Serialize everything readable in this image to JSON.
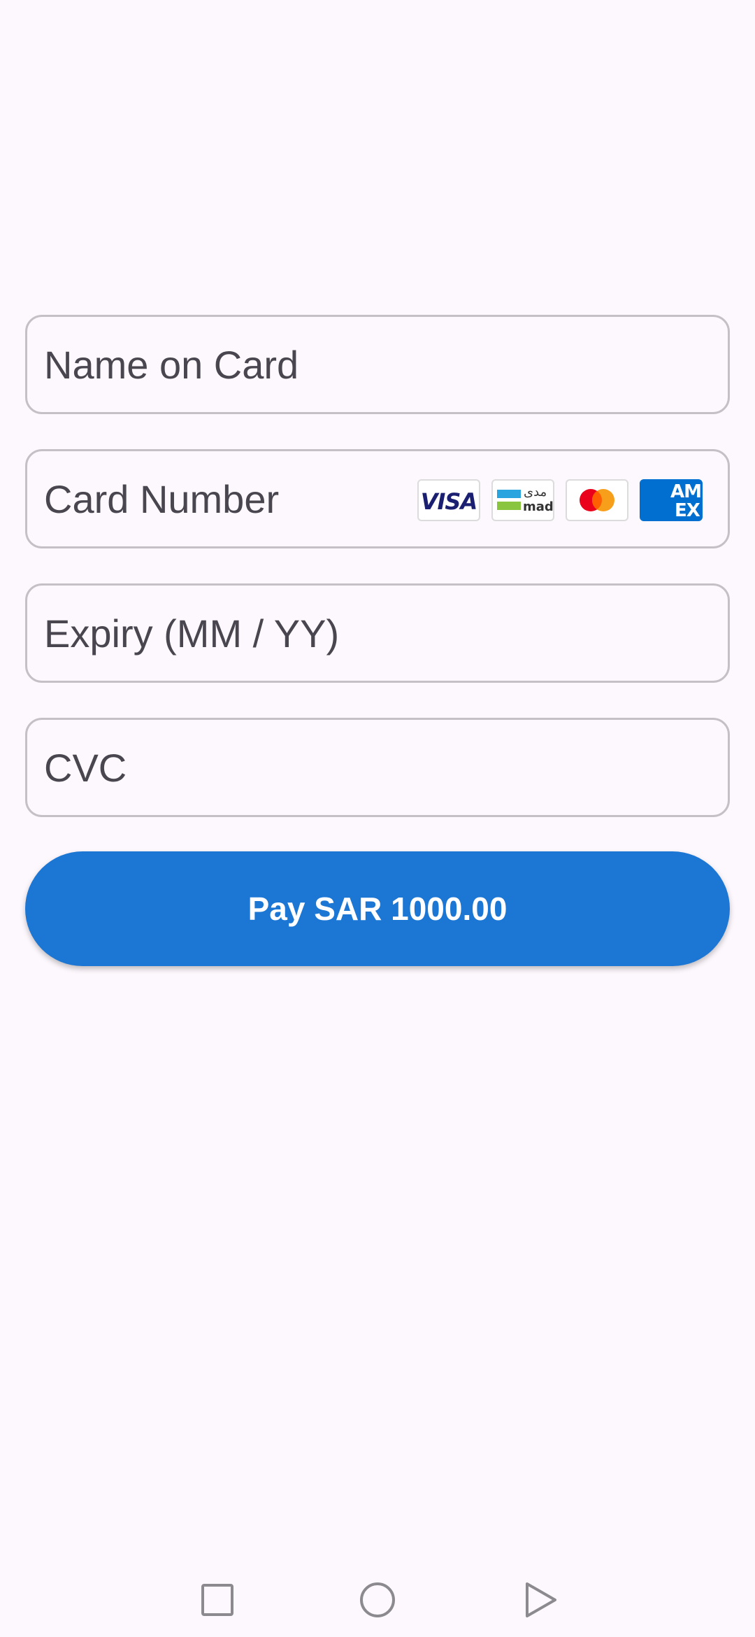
{
  "form": {
    "name_placeholder": "Name on Card",
    "card_number_placeholder": "Card Number",
    "expiry_placeholder": "Expiry (MM / YY)",
    "cvc_placeholder": "CVC"
  },
  "card_brands": {
    "visa": "VISA",
    "mada_ar": "مدى",
    "mada_en": "mada",
    "amex_line1": "AM",
    "amex_line2": "EX"
  },
  "pay_button": {
    "label": "Pay SAR 1000.00"
  },
  "colors": {
    "background": "#fdf8fd",
    "accent": "#1b76d4",
    "field_border": "#c4c0c6",
    "placeholder": "#4a4650"
  },
  "icons": {
    "mastercard": "mastercard-logo",
    "nav_recents": "square-icon",
    "nav_home": "circle-icon",
    "nav_back": "triangle-icon"
  }
}
